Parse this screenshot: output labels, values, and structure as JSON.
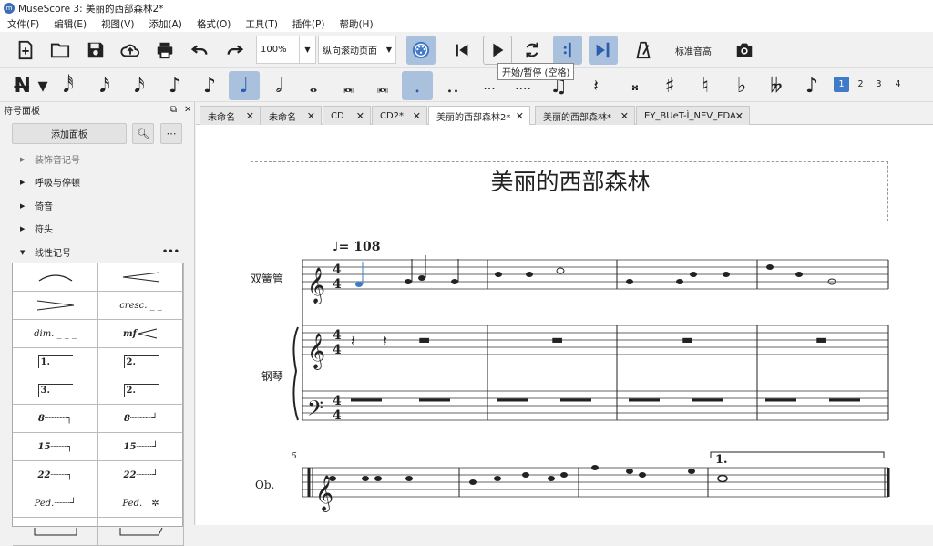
{
  "window": {
    "title": "MuseScore 3: 美丽的西部森林2*",
    "icon": "musescore-icon"
  },
  "menu": [
    "文件(F)",
    "编辑(E)",
    "视图(V)",
    "添加(A)",
    "格式(O)",
    "工具(T)",
    "插件(P)",
    "帮助(H)"
  ],
  "toolbar": {
    "zoom_value": "100%",
    "view_mode": "纵向滚动页面",
    "tooltip": "开始/暂停 (空格)",
    "concert_pitch": "标准音高"
  },
  "voices": [
    "1",
    "2",
    "3",
    "4"
  ],
  "palette": {
    "header": "符号面板",
    "add_panel": "添加面板",
    "items": [
      "装饰音记号",
      "呼吸与停顿",
      "倚音",
      "符头",
      "线性记号"
    ],
    "more_icon": "•••",
    "cells": [
      "slur",
      "crescendo-hairpin",
      "diminuendo-hairpin",
      "cresc. _ _",
      "dim. _ _ _",
      "mf <",
      "1.",
      "2.",
      "3.",
      "2.",
      "8",
      "8",
      "15",
      "15",
      "22",
      "22",
      "Ped.",
      "Ped. ✲",
      "bracket-line",
      "bracket-line-right"
    ],
    "cell_labels": {
      "cresc": "cresc. _ _",
      "dim": "dim. _ _ _",
      "mf": "mf",
      "v1": "1.",
      "v2": "2.",
      "v3": "3.",
      "v2b": "2.",
      "o8": "8",
      "o8b": "8",
      "o15": "15",
      "o15b": "15",
      "o22": "22",
      "o22b": "22",
      "ped": "Ped.",
      "ped2": "Ped."
    }
  },
  "tabs": [
    {
      "label": "未命名"
    },
    {
      "label": "未命名"
    },
    {
      "label": "CD"
    },
    {
      "label": "CD2*"
    },
    {
      "label": "美丽的西部森林2*"
    },
    {
      "label": "美丽的西部森林*"
    },
    {
      "label": "EY_BUeT-Ì_NEV_EDA"
    }
  ],
  "score": {
    "title": "美丽的西部森林",
    "tempo": "= 108",
    "instrument1": "双簧管",
    "instrument2": "钢琴",
    "instrument3": "Ob.",
    "measure_number": "5",
    "volta": "1."
  }
}
